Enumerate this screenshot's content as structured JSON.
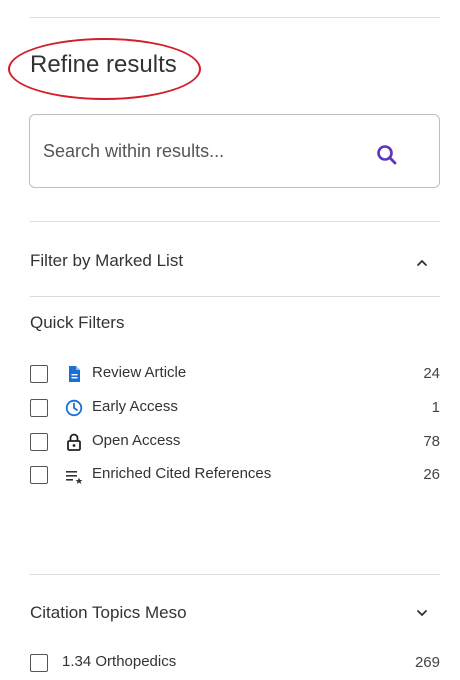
{
  "panel": {
    "title": "Refine results",
    "search": {
      "placeholder": "Search within results..."
    },
    "sections": {
      "marked_list": {
        "title": "Filter by Marked List",
        "state": "expanded"
      },
      "quick_filters": {
        "title": "Quick Filters",
        "items": [
          {
            "label": "Review Article",
            "count": "24",
            "icon": "document-icon"
          },
          {
            "label": "Early Access",
            "count": "1",
            "icon": "clock-icon"
          },
          {
            "label": "Open Access",
            "count": "78",
            "icon": "unlock-icon"
          },
          {
            "label": "Enriched Cited References",
            "count": "26",
            "icon": "list-star-icon"
          }
        ]
      },
      "citation_topics": {
        "title": "Citation Topics Meso",
        "state": "collapsed",
        "items": [
          {
            "label": "1.34 Orthopedics",
            "count": "269"
          }
        ]
      }
    }
  },
  "colors": {
    "accent": "#5e33bf",
    "icon_blue": "#1a6fd6",
    "highlight_oval": "#d21f2b"
  }
}
